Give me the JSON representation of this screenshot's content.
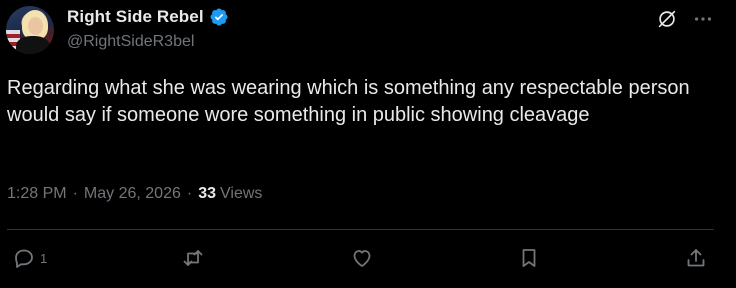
{
  "author": {
    "display_name": "Right Side Rebel",
    "handle": "@RightSideR3bel",
    "verified": true
  },
  "tweet": {
    "text": "Regarding what she was wearing which is something any respectable person would say if someone wore something in public showing cleavage",
    "time": "1:28 PM",
    "separator": "·",
    "date": "May 26, 2026",
    "views_count": "33",
    "views_label": "Views"
  },
  "actions": {
    "reply_count": "1",
    "retweet_count": "",
    "like_count": "",
    "bookmark_count": ""
  },
  "icons": {
    "verified": "verified-badge-icon",
    "grok": "grok-icon",
    "more": "more-icon",
    "reply": "reply-icon",
    "retweet": "retweet-icon",
    "like": "like-icon",
    "bookmark": "bookmark-icon",
    "share": "share-icon"
  },
  "colors": {
    "background": "#000000",
    "text": "#e7e9ea",
    "secondary": "#71767b",
    "verified": "#1d9bf0",
    "divider": "#2f3336"
  }
}
